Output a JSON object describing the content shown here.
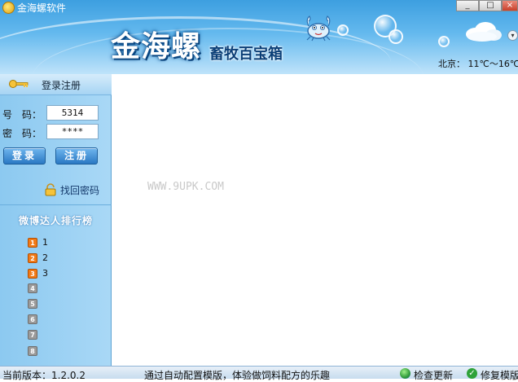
{
  "window": {
    "title": "金海螺软件",
    "minimize": "_",
    "restore": "□",
    "close": "×"
  },
  "header": {
    "brand": "金海螺",
    "subtitle": "畜牧百宝箱",
    "weather": "北京： 11℃～16℃"
  },
  "login": {
    "title": "登录注册",
    "account_label": "号　码：",
    "account_value": "5314",
    "password_label": "密　码：",
    "password_value": "****",
    "login_button": "登录",
    "register_button": "注册",
    "forgot_link": "找回密码"
  },
  "ranking": {
    "title": "微博达人排行榜",
    "items": [
      {
        "badge": "1",
        "text": "1"
      },
      {
        "badge": "2",
        "text": "2"
      },
      {
        "badge": "3",
        "text": "3"
      },
      {
        "badge": "4",
        "text": ""
      },
      {
        "badge": "5",
        "text": ""
      },
      {
        "badge": "6",
        "text": ""
      },
      {
        "badge": "7",
        "text": ""
      },
      {
        "badge": "8",
        "text": ""
      }
    ]
  },
  "content": {
    "watermark": "WWW.9UPK.COM"
  },
  "status": {
    "version": "当前版本：1.2.0.2",
    "message": "通过自动配置模版，体验做饲料配方的乐趣",
    "check_update": "检查更新",
    "repair": "修复模版"
  },
  "colors": {
    "accent": "#2a78c3",
    "header": "#3d9fe0",
    "sidebar": "#9fd2f4",
    "rank_hot": "#f07a18",
    "rank_cold": "#9a9a9a"
  }
}
